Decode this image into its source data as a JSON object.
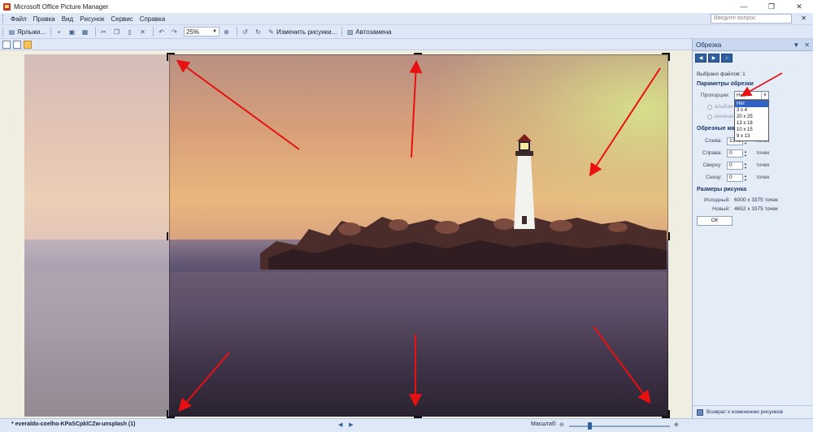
{
  "window": {
    "title": "Microsoft Office Picture Manager",
    "controls": {
      "minimize": "—",
      "maximize": "❐",
      "close": "✕"
    }
  },
  "menu": {
    "items": [
      "Файл",
      "Правка",
      "Вид",
      "Рисунок",
      "Сервис",
      "Справка"
    ],
    "help_placeholder": "Введите вопрос",
    "help_close": "✕"
  },
  "toolbar": {
    "shortcuts_label": "Ярлыки...",
    "zoom_value": "25%",
    "edit_pictures_label": "Изменить рисунки...",
    "autocorrect_label": "Автозамена"
  },
  "task_pane": {
    "title": "Обрезка",
    "selected_files": "Выбрано файлов: 1",
    "crop_params_heading": "Параметры обрезки",
    "proportions_label": "Пропорции:",
    "proportion_value": "Нет",
    "proportion_options": [
      "Нет",
      "3 x 4",
      "20 x 25",
      "13 x 18",
      "10 x 15",
      "9 x 13"
    ],
    "landscape_label": "альбом",
    "portrait_label": "книжная",
    "crop_handles_heading": "Обрезные маркеры",
    "left_label": "Слева:",
    "left_value": "1348",
    "right_label": "Справа:",
    "right_value": "0",
    "top_label": "Сверху:",
    "top_value": "0",
    "bottom_label": "Снизу:",
    "bottom_value": "0",
    "unit": "точек",
    "picture_size_heading": "Размеры рисунка",
    "original_label": "Исходный:",
    "original_value": "6000 x 3375 точек",
    "new_label": "Новый:",
    "new_value": "4652 x 3375 точек",
    "ok_label": "ОК",
    "footer_link": "Возврат к изменению рисунков"
  },
  "status": {
    "filename": "* everaldo-coelho-KPaSCpklCZw-unsplash (1)",
    "zoom_label": "Масштаб:",
    "zoom_level": 0.2
  }
}
